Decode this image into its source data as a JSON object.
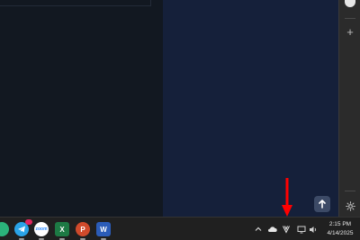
{
  "colors": {
    "app_left_bg": "#121821",
    "app_right_bg": "#15203a",
    "edge_bar_bg": "#2b2b2b",
    "taskbar_bg": "#202020",
    "annotation_arrow": "#ff0000"
  },
  "edge_sidebar": {
    "profile_icon": "profile-avatar-icon",
    "add_icon": "plus-icon",
    "settings_icon": "gear-icon"
  },
  "scroll_top": {
    "icon": "arrow-up-icon"
  },
  "taskbar": {
    "pinned_apps": [
      {
        "name": "app-partial",
        "icon": "green-circle-icon",
        "color": "#2bb37a",
        "label": ""
      },
      {
        "name": "telegram",
        "icon": "telegram-icon",
        "color": "#2aa3e6",
        "label": ""
      },
      {
        "name": "zoom",
        "icon": "zoom-icon",
        "color": "#ffffff",
        "label": "zoom"
      },
      {
        "name": "excel",
        "icon": "excel-icon",
        "color": "#1d7a44",
        "label": "X"
      },
      {
        "name": "powerpoint",
        "icon": "powerpoint-icon",
        "color": "#d04a2b",
        "label": "P"
      },
      {
        "name": "word",
        "icon": "word-icon",
        "color": "#2b5cb8",
        "label": "W"
      }
    ],
    "telegram_badge": "",
    "tray": {
      "icons": [
        "chevron-up-icon",
        "onedrive-cloud-icon",
        "vpn-v-icon",
        "display-icon",
        "speaker-icon"
      ]
    },
    "clock": {
      "time": "2:15 PM",
      "date": "4/14/2025"
    }
  }
}
